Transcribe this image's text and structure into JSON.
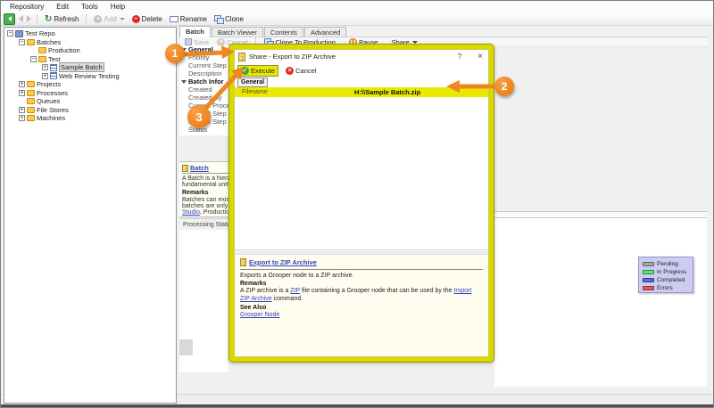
{
  "menu_bar": {
    "items": [
      {
        "label": "Repository"
      },
      {
        "label": "Edit"
      },
      {
        "label": "Tools"
      },
      {
        "label": "Help"
      }
    ]
  },
  "main_toolbar": {
    "refresh_label": "Refresh",
    "add_label": "Add",
    "delete_label": "Delete",
    "rename_label": "Rename",
    "clone_label": "Clone"
  },
  "tabs": [
    {
      "label": "Batch",
      "active": true
    },
    {
      "label": "Batch Viewer"
    },
    {
      "label": "Contents"
    },
    {
      "label": "Advanced"
    }
  ],
  "batch_toolbar": {
    "save_label": "Save",
    "cancel_label": "Cancel",
    "clone_to_production_label": "Clone To Production...",
    "pause_label": "Pause...",
    "share_label": "Share"
  },
  "tree": {
    "items": [
      {
        "label": "Test Repo",
        "level": 0,
        "expander": "minus",
        "icon": "repo"
      },
      {
        "label": "Batches",
        "level": 1,
        "expander": "minus",
        "icon": "folder"
      },
      {
        "label": "Production",
        "level": 2,
        "expander": "none",
        "icon": "folder"
      },
      {
        "label": "Test",
        "level": 2,
        "expander": "minus",
        "icon": "folder"
      },
      {
        "label": "Sample Batch",
        "level": 3,
        "expander": "plus",
        "icon": "batch",
        "selected": true
      },
      {
        "label": "Web Review Testing",
        "level": 3,
        "expander": "plus",
        "icon": "batch"
      },
      {
        "label": "Projects",
        "level": 1,
        "expander": "plus",
        "icon": "folder"
      },
      {
        "label": "Processes",
        "level": 1,
        "expander": "plus",
        "icon": "folder"
      },
      {
        "label": "Queues",
        "level": 1,
        "expander": "none",
        "icon": "folder"
      },
      {
        "label": "File Stores",
        "level": 1,
        "expander": "plus",
        "icon": "folder"
      },
      {
        "label": "Machines",
        "level": 1,
        "expander": "plus",
        "icon": "folder"
      }
    ]
  },
  "property_grid": {
    "rows": [
      {
        "label": "General",
        "bold": true,
        "chevron": true
      },
      {
        "label": "Priority"
      },
      {
        "label": "Current Step"
      },
      {
        "label": "Description"
      },
      {
        "label": "Batch Infor",
        "bold": true,
        "chevron": true
      },
      {
        "label": "Created"
      },
      {
        "label": "Created By"
      },
      {
        "label": "Current Process"
      },
      {
        "label": "Current Step Na"
      },
      {
        "label": "Current Step No"
      },
      {
        "label": "Status"
      }
    ]
  },
  "batch_help_panel": {
    "title_link": "Batch",
    "line1": "A Batch is a hiera",
    "line2": "fundamental unit o",
    "remarks_label": "Remarks",
    "line3": "Batches can exist",
    "line4": "batches are only v",
    "studio_link": "Studio",
    "line5": ", Productio"
  },
  "processing_status_label": "Processing Status",
  "dialog": {
    "title": "Share - Export to ZIP Archive",
    "help_button": "?",
    "close_button": "×",
    "execute_label": "Execute",
    "cancel_label": "Cancel",
    "group_label": "General",
    "filename_label": "Filename",
    "filename_value": "H:\\\\Sample Batch.zip",
    "help": {
      "title_link": "Export to ZIP Archive",
      "summary": "Exports a Grooper node to a ZIP archive.",
      "remarks_label": "Remarks",
      "remarks_text_1": "A ZIP archive is a ",
      "zip_link": "ZIP",
      "remarks_text_2": " file containing a Grooper node that can be used by the ",
      "import_link": "Import ZIP Archive",
      "remarks_text_3": " command.",
      "see_also_label": "See Also",
      "see_also_link": "Grooper Node"
    }
  },
  "legend": {
    "items": [
      {
        "label": "Pending",
        "color": "#a6a6a6"
      },
      {
        "label": "In Progress",
        "color": "#58e96a"
      },
      {
        "label": "Completed",
        "color": "#5b6bd5"
      },
      {
        "label": "Errors",
        "color": "#ee5555"
      }
    ]
  },
  "callouts": {
    "one": "1",
    "two": "2",
    "three": "3",
    "accent_color": "#ee8622"
  }
}
